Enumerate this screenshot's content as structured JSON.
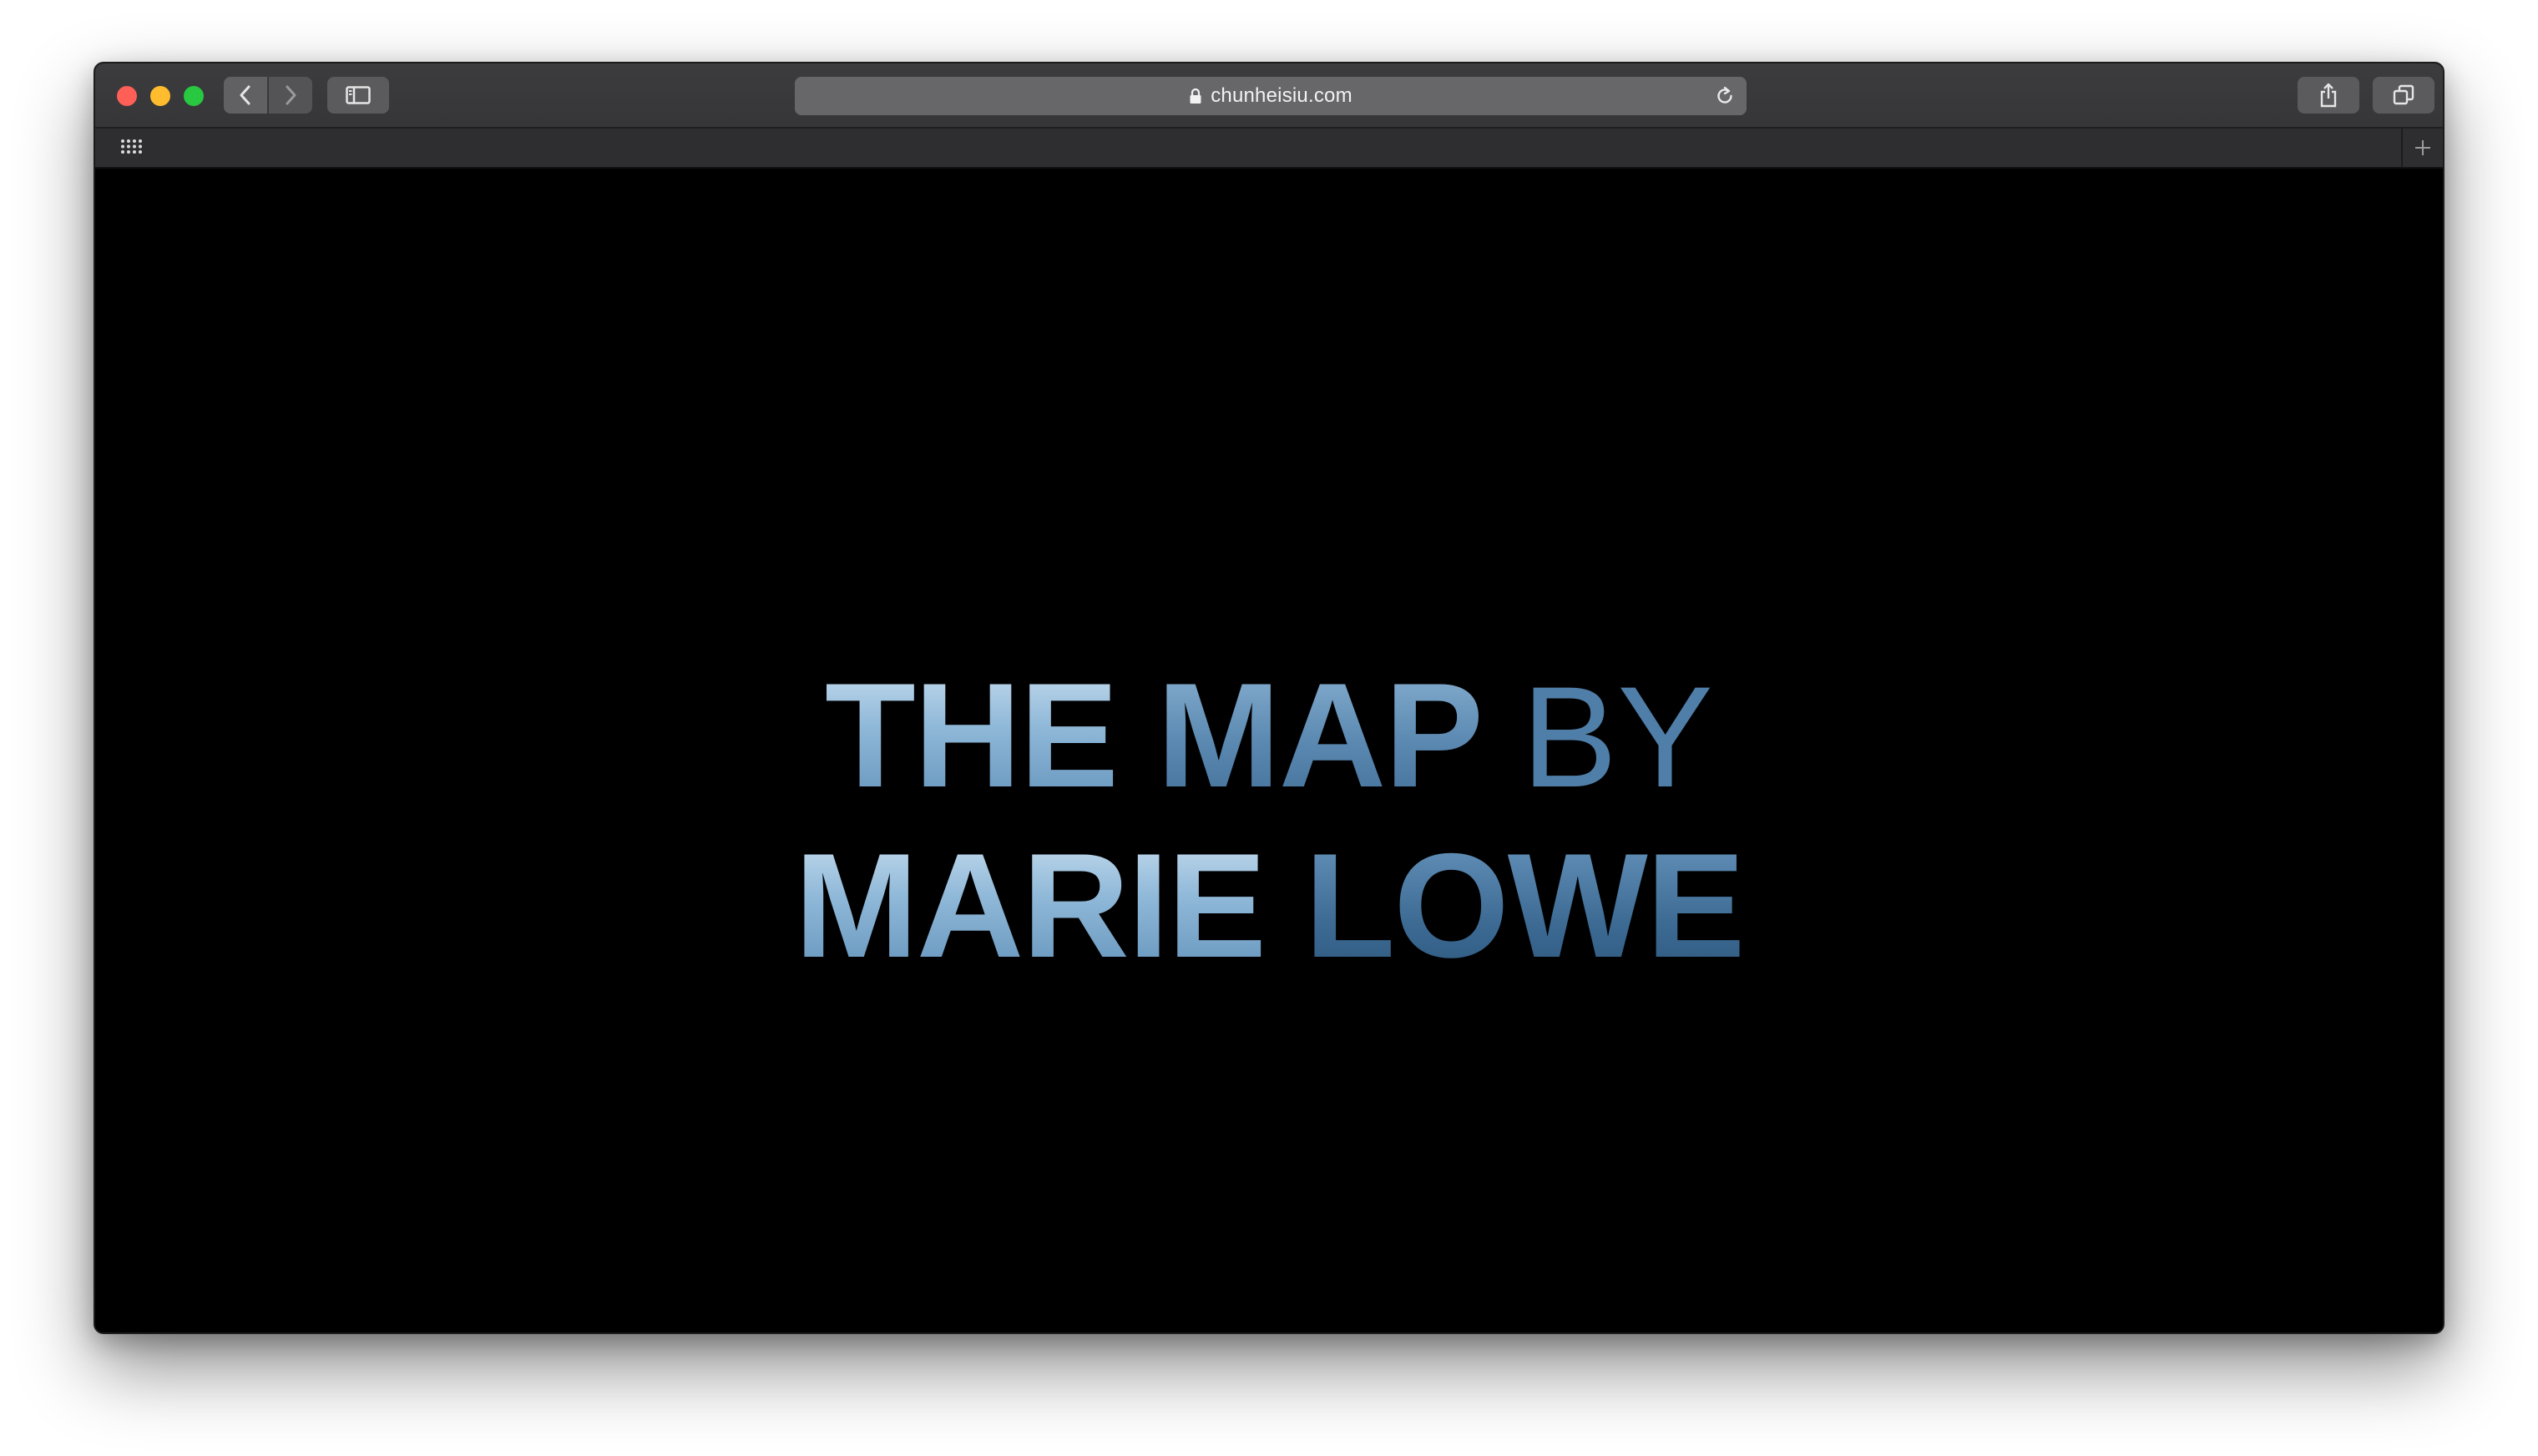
{
  "browser": {
    "url": "chunheisiu.com",
    "icons": {
      "back": "chevron-left-icon",
      "forward": "chevron-right-icon",
      "sidebar": "sidebar-icon",
      "lock": "lock-icon",
      "reload": "reload-icon",
      "share": "share-icon",
      "tabs": "tabs-overview-icon",
      "favorites": "grid-icon",
      "new_tab": "plus-icon"
    }
  },
  "page": {
    "line1": {
      "w1": "THE",
      "w2": "MAP",
      "w3": "BY"
    },
    "line2": {
      "w1": "MARIE",
      "w2": "LOWE"
    }
  }
}
